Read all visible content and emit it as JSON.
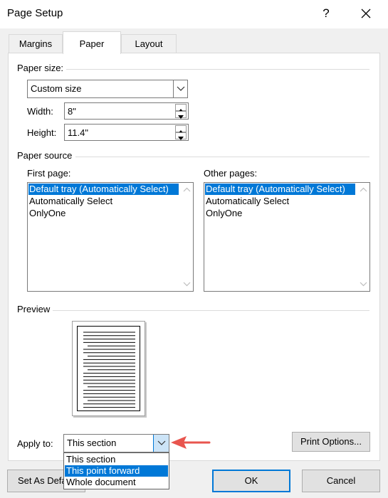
{
  "window": {
    "title": "Page Setup",
    "help_label": "?",
    "close_label": "✕"
  },
  "tabs": [
    {
      "label": "Margins",
      "active": false
    },
    {
      "label": "Paper",
      "active": true
    },
    {
      "label": "Layout",
      "active": false
    }
  ],
  "paper_size": {
    "group_label": "Paper size:",
    "selected": "Custom size",
    "width_label": "Width:",
    "width_value": "8\"",
    "height_label": "Height:",
    "height_value": "11.4\""
  },
  "paper_source": {
    "group_label": "Paper source",
    "first_page_label": "First page:",
    "other_pages_label": "Other pages:",
    "first_page_items": [
      "Default tray (Automatically Select)",
      "Automatically Select",
      "OnlyOne"
    ],
    "other_pages_items": [
      "Default tray (Automatically Select)",
      "Automatically Select",
      "OnlyOne"
    ],
    "first_page_selected": 0,
    "other_pages_selected": 0
  },
  "preview": {
    "group_label": "Preview"
  },
  "apply_to": {
    "label": "Apply to:",
    "value": "This section",
    "options": [
      "This section",
      "This point forward",
      "Whole document"
    ],
    "highlighted": 1
  },
  "buttons": {
    "print_options": "Print Options...",
    "set_as_default": "Set As Default",
    "ok": "OK",
    "cancel": "Cancel"
  },
  "colors": {
    "selection": "#0078d7",
    "arrow": "#e8554e"
  }
}
